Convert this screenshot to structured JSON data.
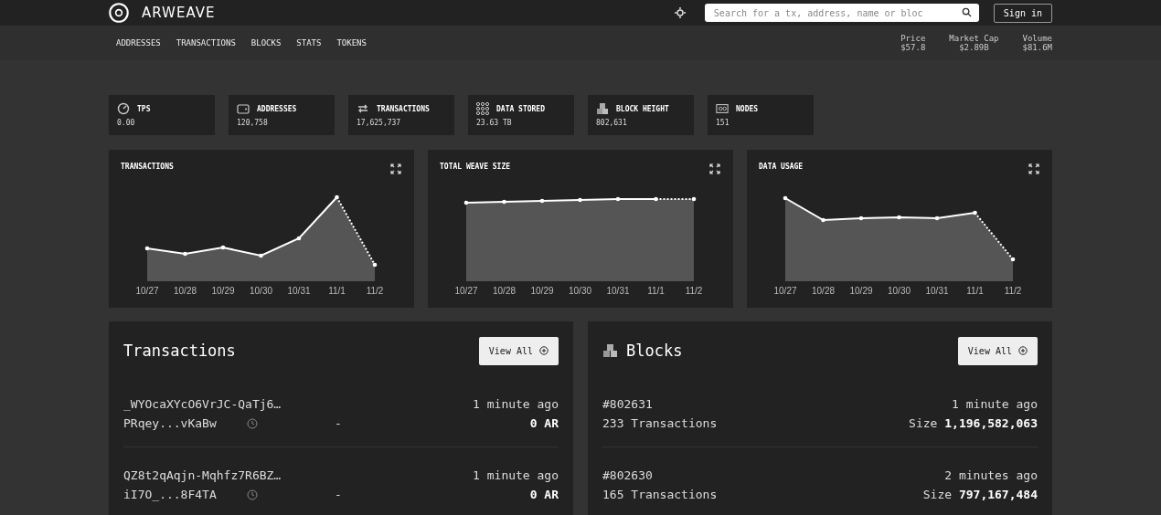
{
  "header": {
    "brand": "ARWEAVE",
    "search": {
      "placeholder": "Search for a tx, address, name or bloc"
    },
    "sign_in": "Sign in"
  },
  "nav": {
    "items": [
      "ADDRESSES",
      "TRANSACTIONS",
      "BLOCKS",
      "STATS",
      "TOKENS"
    ]
  },
  "market": [
    {
      "label": "Price",
      "value": "$57.8"
    },
    {
      "label": "Market Cap",
      "value": "$2.89B"
    },
    {
      "label": "Volume",
      "value": "$81.6M"
    }
  ],
  "stats": [
    {
      "kind": "gauge",
      "label": "TPS",
      "value": "0.00"
    },
    {
      "kind": "wallet",
      "label": "ADDRESSES",
      "value": "120,758"
    },
    {
      "kind": "arrows",
      "label": "TRANSACTIONS",
      "value": "17,625,737"
    },
    {
      "kind": "data",
      "label": "DATA STORED",
      "value": "23.63 TB"
    },
    {
      "kind": "blocks",
      "label": "BLOCK HEIGHT",
      "value": "802,631"
    },
    {
      "kind": "nodes",
      "label": "NODES",
      "value": "151"
    }
  ],
  "charts": [
    {
      "kind": "transactions",
      "title": "TRANSACTIONS",
      "x_labels": [
        "10/27",
        "10/28",
        "10/29",
        "10/30",
        "10/31",
        "11/1",
        "11/2"
      ]
    },
    {
      "kind": "weave",
      "title": "TOTAL WEAVE SIZE",
      "x_labels": [
        "10/27",
        "10/28",
        "10/29",
        "10/30",
        "10/31",
        "11/1",
        "11/2"
      ]
    },
    {
      "kind": "usage",
      "title": "DATA USAGE",
      "x_labels": [
        "10/27",
        "10/28",
        "10/29",
        "10/30",
        "10/31",
        "11/1",
        "11/2"
      ]
    }
  ],
  "transactions": {
    "title": "Transactions",
    "view_all": "View All",
    "rows": [
      {
        "id": "_WYOcaXYcO6VrJC-QaTj6…",
        "owner": "PRqey...vKaBw",
        "target": "-",
        "time": "1 minute ago",
        "amount": "0 AR"
      },
      {
        "id": "QZ8t2qAqjn-Mqhfz7R6BZ…",
        "owner": "iI7O_...8F4TA",
        "target": "-",
        "time": "1 minute ago",
        "amount": "0 AR"
      }
    ]
  },
  "blocks": {
    "title": "Blocks",
    "view_all": "View All",
    "rows": [
      {
        "height": "#802631",
        "tx_count": "233 Transactions",
        "time": "1 minute ago",
        "size_label": "Size",
        "size": "1,196,582,063"
      },
      {
        "height": "#802630",
        "tx_count": "165 Transactions",
        "time": "2 minutes ago",
        "size_label": "Size",
        "size": "797,167,484"
      }
    ]
  }
}
